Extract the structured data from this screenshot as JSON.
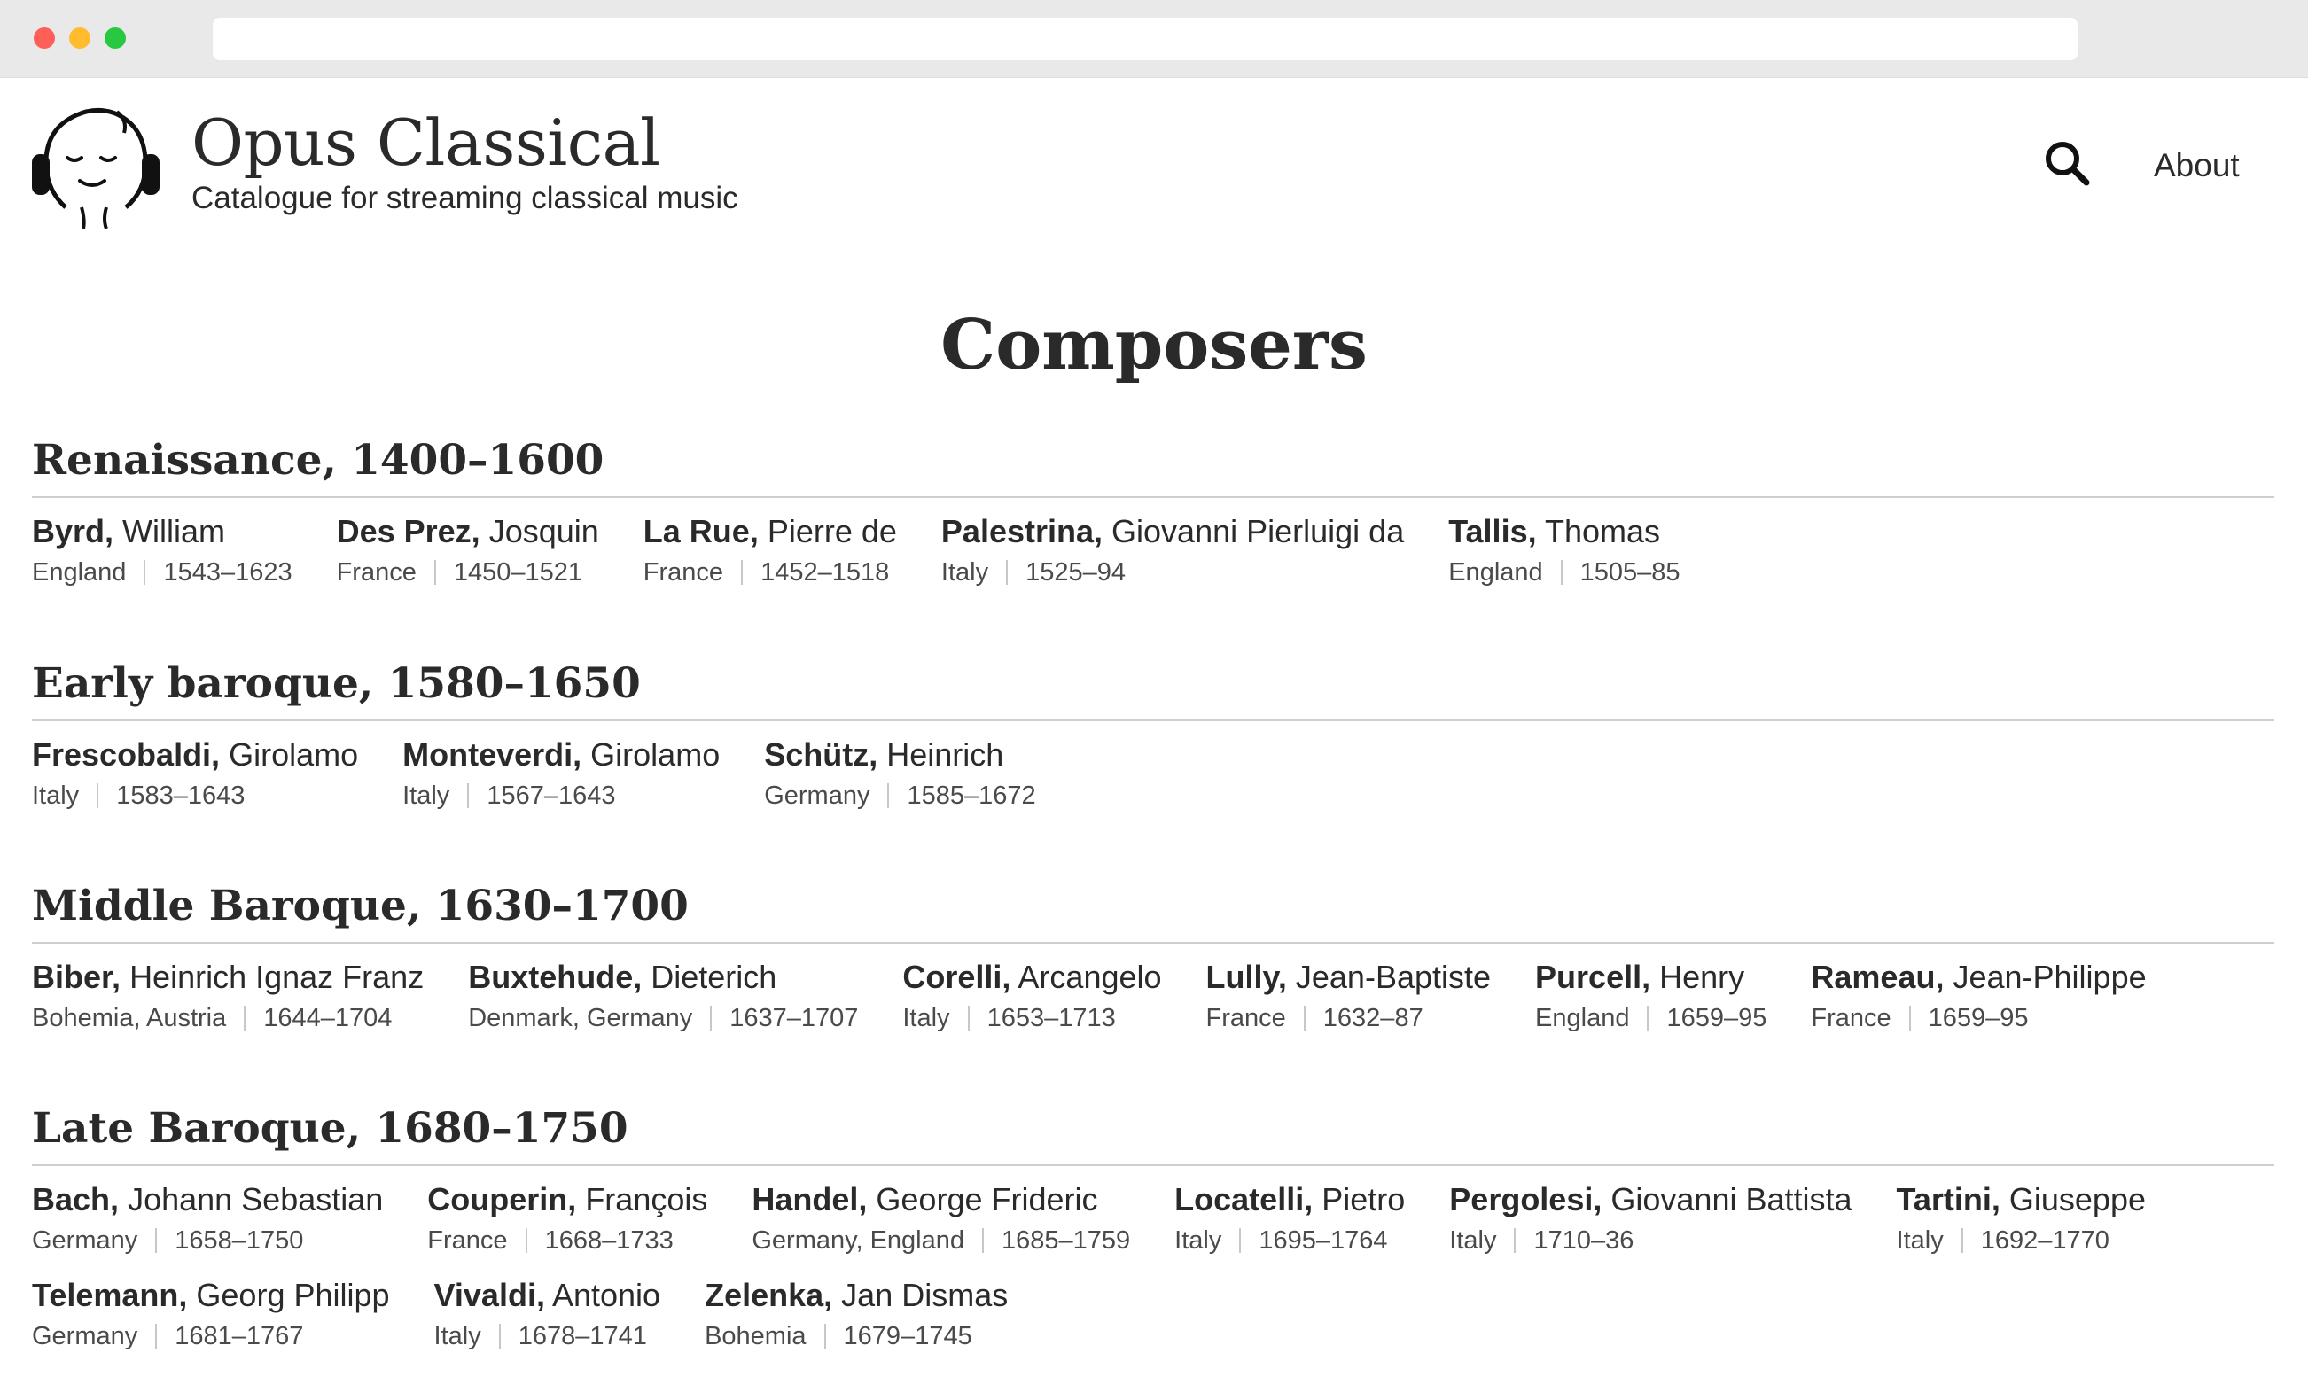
{
  "header": {
    "title": "Opus Classical",
    "subtitle": "Catalogue for streaming classical music",
    "search_icon": "search-icon",
    "about_label": "About"
  },
  "page_title": "Composers",
  "periods": [
    {
      "heading": "Renaissance, 1400–1600",
      "composers": [
        {
          "last": "Byrd,",
          "first": "William",
          "country": "England",
          "years": "1543–1623"
        },
        {
          "last": "Des Prez,",
          "first": "Josquin",
          "country": "France",
          "years": "1450–1521"
        },
        {
          "last": "La Rue,",
          "first": "Pierre de",
          "country": "France",
          "years": "1452–1518"
        },
        {
          "last": "Palestrina,",
          "first": "Giovanni Pierluigi da",
          "country": "Italy",
          "years": "1525–94"
        },
        {
          "last": "Tallis,",
          "first": "Thomas",
          "country": "England",
          "years": "1505–85"
        }
      ]
    },
    {
      "heading": "Early baroque, 1580–1650",
      "composers": [
        {
          "last": "Frescobaldi,",
          "first": "Girolamo",
          "country": "Italy",
          "years": "1583–1643"
        },
        {
          "last": "Monteverdi,",
          "first": "Girolamo",
          "country": "Italy",
          "years": "1567–1643"
        },
        {
          "last": "Schütz,",
          "first": "Heinrich",
          "country": "Germany",
          "years": "1585–1672"
        }
      ]
    },
    {
      "heading": "Middle Baroque, 1630–1700",
      "composers": [
        {
          "last": "Biber,",
          "first": "Heinrich Ignaz Franz",
          "country": "Bohemia, Austria",
          "years": "1644–1704"
        },
        {
          "last": "Buxtehude,",
          "first": "Dieterich",
          "country": "Denmark, Germany",
          "years": "1637–1707"
        },
        {
          "last": "Corelli,",
          "first": "Arcangelo",
          "country": "Italy",
          "years": "1653–1713"
        },
        {
          "last": "Lully,",
          "first": "Jean-Baptiste",
          "country": "France",
          "years": "1632–87"
        },
        {
          "last": "Purcell,",
          "first": "Henry",
          "country": "England",
          "years": "1659–95"
        },
        {
          "last": "Rameau,",
          "first": "Jean-Philippe",
          "country": "France",
          "years": "1659–95"
        }
      ]
    },
    {
      "heading": "Late Baroque, 1680–1750",
      "composers": [
        {
          "last": "Bach,",
          "first": "Johann Sebastian",
          "country": "Germany",
          "years": "1658–1750"
        },
        {
          "last": "Couperin,",
          "first": "François",
          "country": "France",
          "years": "1668–1733"
        },
        {
          "last": "Handel,",
          "first": "George Frideric",
          "country": "Germany, England",
          "years": "1685–1759"
        },
        {
          "last": "Locatelli,",
          "first": "Pietro",
          "country": "Italy",
          "years": "1695–1764"
        },
        {
          "last": "Pergolesi,",
          "first": "Giovanni Battista",
          "country": "Italy",
          "years": "1710–36"
        },
        {
          "last": "Tartini,",
          "first": "Giuseppe",
          "country": "Italy",
          "years": "1692–1770"
        },
        {
          "last": "Telemann,",
          "first": "Georg Philipp",
          "country": "Germany",
          "years": "1681–1767"
        },
        {
          "last": "Vivaldi,",
          "first": "Antonio",
          "country": "Italy",
          "years": "1678–1741"
        },
        {
          "last": "Zelenka,",
          "first": "Jan Dismas",
          "country": "Bohemia",
          "years": "1679–1745"
        }
      ]
    }
  ]
}
